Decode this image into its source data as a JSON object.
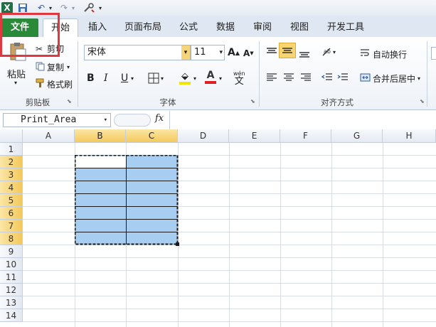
{
  "qat": {
    "excel_logo": "X",
    "undo": "↶",
    "redo": "↷",
    "more": "▾"
  },
  "tabs": [
    "文件",
    "开始",
    "插入",
    "页面布局",
    "公式",
    "数据",
    "审阅",
    "视图",
    "开发工具"
  ],
  "ribbon": {
    "clipboard": {
      "paste": "粘贴",
      "cut": "剪切",
      "copy": "复制",
      "format_painter": "格式刷",
      "label": "剪贴板"
    },
    "font": {
      "name": "宋体",
      "size": "11",
      "bold": "B",
      "italic": "I",
      "underline": "U",
      "font_color": "A",
      "wen": "wén",
      "label": "字体"
    },
    "alignment": {
      "wrap": "自动换行",
      "merge": "合并后居中",
      "label": "对齐方式"
    }
  },
  "formula_bar": {
    "name_box": "Print_Area",
    "fx": "fx",
    "value": ""
  },
  "columns": [
    "A",
    "B",
    "C",
    "D",
    "E",
    "F",
    "G",
    "H"
  ],
  "rows": [
    "1",
    "2",
    "3",
    "4",
    "5",
    "6",
    "7",
    "8",
    "9",
    "10",
    "11",
    "12",
    "13",
    "14"
  ],
  "colors": {
    "file_tab": "#2a8a3a",
    "selection_fill": "#a7cdf0",
    "header_highlight": "#f4c95c",
    "callout": "#e0383f"
  },
  "selection": {
    "range": "B2:C8"
  }
}
